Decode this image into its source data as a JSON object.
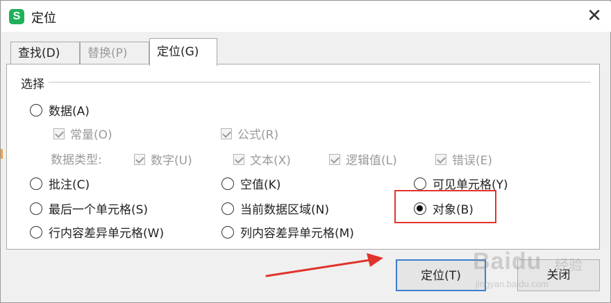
{
  "window": {
    "title": "定位",
    "app_icon_letter": "S",
    "close_glyph": "✕"
  },
  "tabs": [
    {
      "label": "查找(D)",
      "state": "normal"
    },
    {
      "label": "替换(P)",
      "state": "disabled"
    },
    {
      "label": "定位(G)",
      "state": "active"
    }
  ],
  "group": {
    "label": "选择"
  },
  "options": {
    "data": "数据(A)",
    "constant": "常量(O)",
    "formula": "公式(R)",
    "data_type_label": "数据类型:",
    "number": "数字(U)",
    "text": "文本(X)",
    "logical": "逻辑值(L)",
    "error": "错误(E)",
    "comment": "批注(C)",
    "blank": "空值(K)",
    "visible_cells": "可见单元格(Y)",
    "last_cell": "最后一个单元格(S)",
    "current_region": "当前数据区域(N)",
    "object": "对象(B)",
    "row_diff": "行内容差异单元格(W)",
    "col_diff": "列内容差异单元格(M)"
  },
  "selected_option": "object",
  "buttons": {
    "locate": "定位(T)",
    "close": "关闭"
  },
  "watermark": {
    "main": "Baidu",
    "cn": "经验",
    "sub": "jingyan.baidu.com"
  },
  "colors": {
    "highlight": "#e0332c",
    "arrow": "#e0332c",
    "primary_border": "#3c7fd0",
    "app_icon": "#1fb15a"
  }
}
